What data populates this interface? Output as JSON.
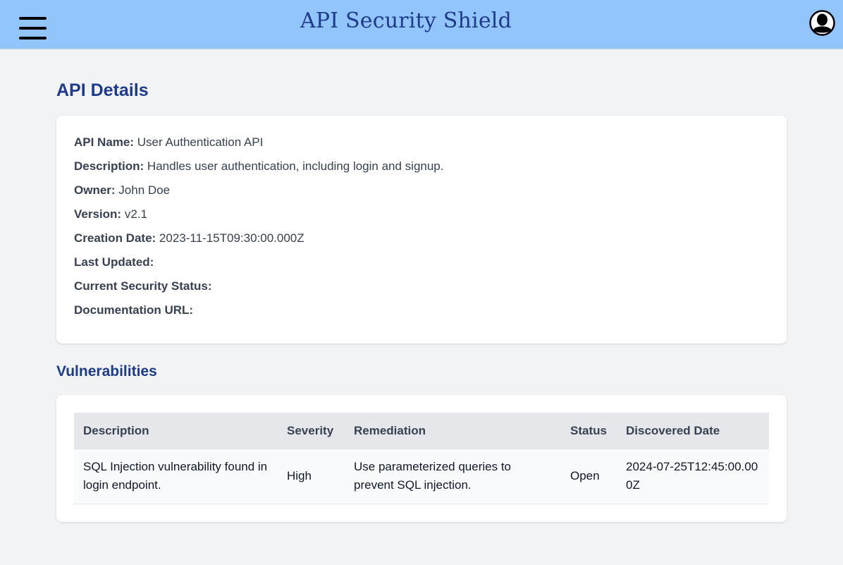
{
  "header": {
    "title": "API Security Shield",
    "menu_icon": "hamburger-menu-icon",
    "avatar_icon": "user-avatar-icon",
    "background": "#93c5fd",
    "title_color": "#1e3a8a"
  },
  "details": {
    "heading": "API Details",
    "fields": [
      {
        "label": "API Name:",
        "value": "User Authentication API"
      },
      {
        "label": "Description:",
        "value": "Handles user authentication, including login and signup."
      },
      {
        "label": "Owner:",
        "value": "John Doe"
      },
      {
        "label": "Version:",
        "value": "v2.1"
      },
      {
        "label": "Creation Date:",
        "value": "2023-11-15T09:30:00.000Z"
      },
      {
        "label": "Last Updated:",
        "value": ""
      },
      {
        "label": "Current Security Status:",
        "value": ""
      },
      {
        "label": "Documentation URL:",
        "value": ""
      }
    ]
  },
  "vulnerabilities": {
    "heading": "Vulnerabilities",
    "columns": [
      "Description",
      "Severity",
      "Remediation",
      "Status",
      "Discovered Date"
    ],
    "rows": [
      {
        "description": "SQL Injection vulnerability found in login endpoint.",
        "severity": "High",
        "remediation": "Use parameterized queries to prevent SQL injection.",
        "status": "Open",
        "discovered": "2024-07-25T12:45:00.000Z"
      }
    ]
  }
}
